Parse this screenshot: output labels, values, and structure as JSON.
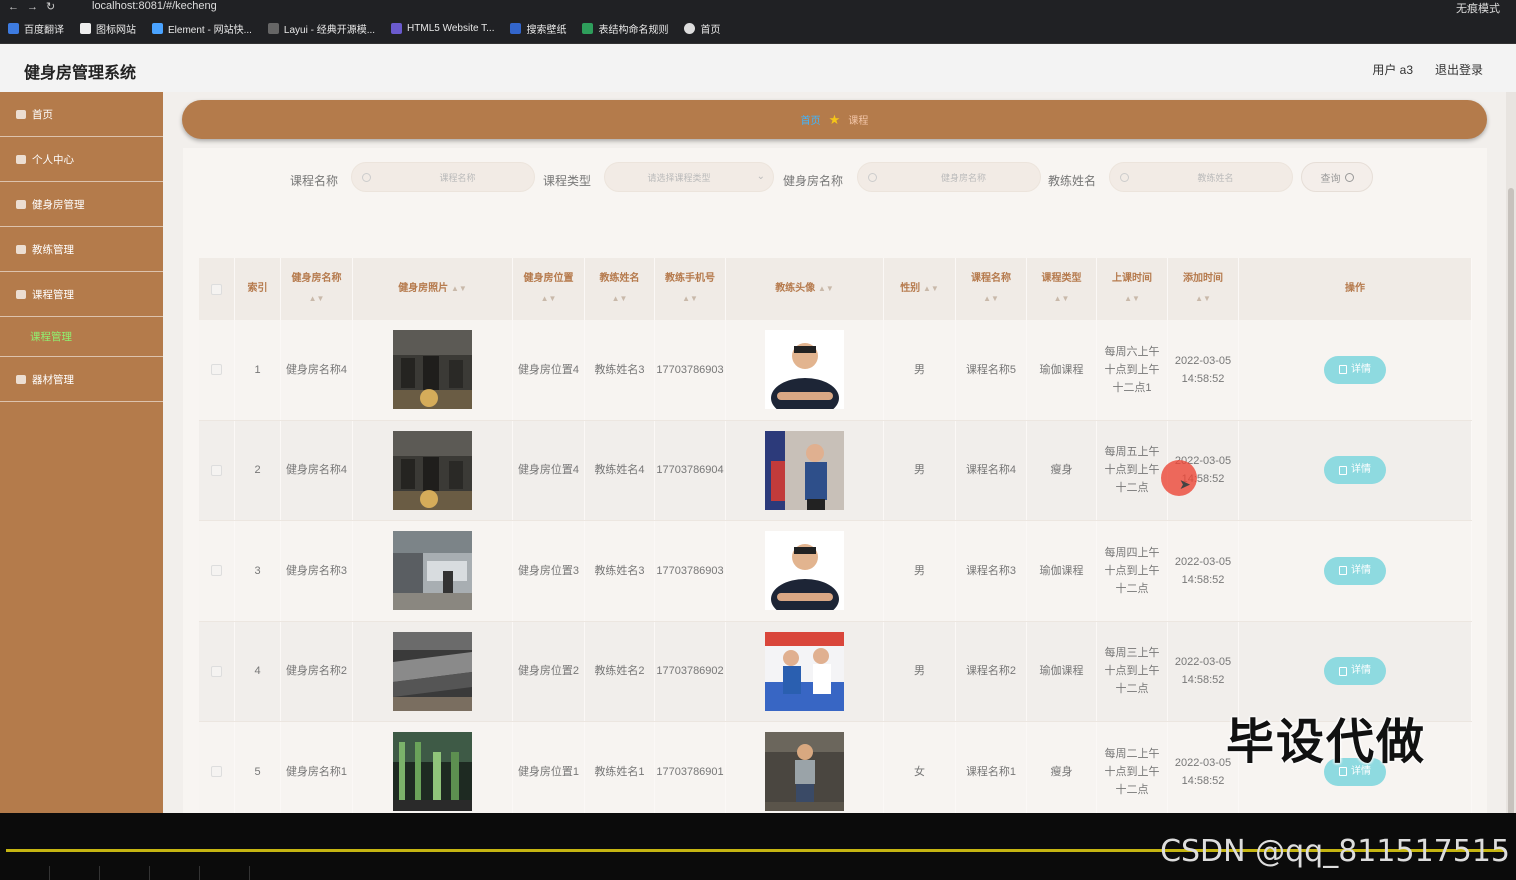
{
  "browser": {
    "url": "localhost:8081/#/kecheng",
    "mode": "无痕模式",
    "bookmarks": [
      "百度翻译",
      "图标网站",
      "Element - 网站快...",
      "Layui - 经典开源模...",
      "HTML5 Website T...",
      "搜索壁纸",
      "表结构命名规则",
      "首页"
    ]
  },
  "header": {
    "title": "健身房管理系统",
    "user": "用户 a3",
    "logout": "退出登录"
  },
  "sidebar": {
    "items": [
      {
        "label": "首页"
      },
      {
        "label": "个人中心"
      },
      {
        "label": "健身房管理"
      },
      {
        "label": "教练管理"
      },
      {
        "label": "课程管理"
      },
      {
        "label": "器材管理"
      }
    ],
    "sub_active": "课程管理"
  },
  "breadcrumb": {
    "home": "首页",
    "current": "课程"
  },
  "search": {
    "label1": "课程名称",
    "placeholder1": "课程名称",
    "label2": "课程类型",
    "placeholder2": "请选择课程类型",
    "label3": "健身房名称",
    "placeholder3": "健身房名称",
    "label4": "教练姓名",
    "placeholder4": "教练姓名",
    "query": "查询"
  },
  "table": {
    "headers": [
      "索引",
      "健身房名称",
      "健身房照片",
      "健身房位置",
      "教练姓名",
      "教练手机号",
      "教练头像",
      "性别",
      "课程名称",
      "课程类型",
      "上课时间",
      "添加时间",
      "操作"
    ],
    "detail_label": "详情",
    "rows": [
      {
        "index": "1",
        "gym": "健身房名称4",
        "loc": "健身房位置4",
        "coach": "教练姓名3",
        "phone": "17703786903",
        "gender": "男",
        "course": "课程名称5",
        "type": "瑜伽课程",
        "time": "每周六上午十点到上午十二点1",
        "added": "2022-03-05 14:58:52"
      },
      {
        "index": "2",
        "gym": "健身房名称4",
        "loc": "健身房位置4",
        "coach": "教练姓名4",
        "phone": "17703786904",
        "gender": "男",
        "course": "课程名称4",
        "type": "瘦身",
        "time": "每周五上午十点到上午十二点",
        "added": "2022-03-05 14:58:52"
      },
      {
        "index": "3",
        "gym": "健身房名称3",
        "loc": "健身房位置3",
        "coach": "教练姓名3",
        "phone": "17703786903",
        "gender": "男",
        "course": "课程名称3",
        "type": "瑜伽课程",
        "time": "每周四上午十点到上午十二点",
        "added": "2022-03-05 14:58:52"
      },
      {
        "index": "4",
        "gym": "健身房名称2",
        "loc": "健身房位置2",
        "coach": "教练姓名2",
        "phone": "17703786902",
        "gender": "男",
        "course": "课程名称2",
        "type": "瑜伽课程",
        "time": "每周三上午十点到上午十二点",
        "added": "2022-03-05 14:58:52"
      },
      {
        "index": "5",
        "gym": "健身房名称1",
        "loc": "健身房位置1",
        "coach": "教练姓名1",
        "phone": "17703786901",
        "gender": "女",
        "course": "课程名称1",
        "type": "瘦身",
        "time": "每周二上午十点到上午十二点",
        "added": "2022-03-05 14:58:52"
      }
    ]
  },
  "overlay": {
    "watermark": "毕设代做",
    "csdn": "CSDN @qq_811517515"
  },
  "colors": {
    "sidebar": "#b47b4b",
    "accent_header": "#b67b4e",
    "detail_button": "#8edae0",
    "active_sub": "#90f070"
  }
}
